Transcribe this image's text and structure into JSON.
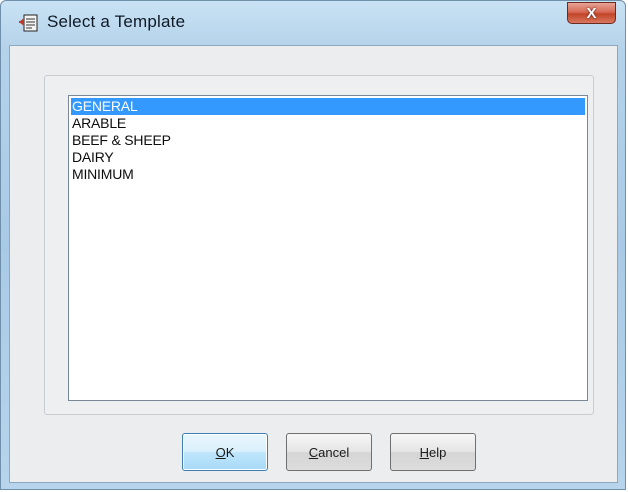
{
  "window": {
    "title": "Select a Template",
    "close_label": "X"
  },
  "template_list": {
    "items": [
      {
        "label": "GENERAL",
        "selected": true
      },
      {
        "label": "ARABLE",
        "selected": false
      },
      {
        "label": "BEEF & SHEEP",
        "selected": false
      },
      {
        "label": "DAIRY",
        "selected": false
      },
      {
        "label": "MINIMUM",
        "selected": false
      }
    ]
  },
  "buttons": {
    "ok": {
      "mnemonic": "O",
      "rest": "K"
    },
    "cancel": {
      "mnemonic": "C",
      "rest": "ancel"
    },
    "help": {
      "mnemonic": "H",
      "rest": "elp"
    }
  },
  "colors": {
    "selection": "#3399ff",
    "close_button": "#c24528"
  }
}
